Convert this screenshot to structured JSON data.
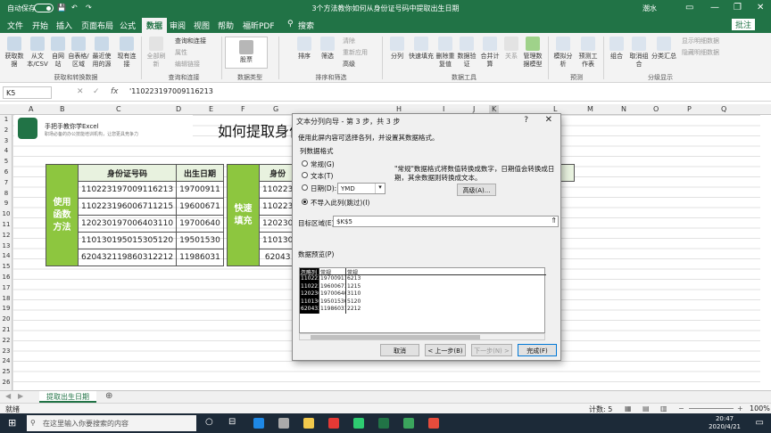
{
  "window": {
    "title": "3个方法教你如何从身份证号码中提取出生日期",
    "autosave": "自动保存",
    "toggle_state": "关",
    "user": "潮水"
  },
  "menus": [
    "文件",
    "开始",
    "插入",
    "页面布局",
    "公式",
    "数据",
    "审阅",
    "视图",
    "帮助",
    "福昕PDF",
    "搜索"
  ],
  "share_label": "批注",
  "ribbon": {
    "buttons": [
      "获取数据",
      "从文本/CSV",
      "自网站",
      "自表格/区域",
      "最近使用的源",
      "现有连接",
      "全部刷新",
      "查询和连接",
      "属性",
      "编辑链接",
      "股票",
      "排序",
      "筛选",
      "清除",
      "重新应用",
      "高级",
      "分列",
      "快速填充",
      "删除重复值",
      "数据验证",
      "合并计算",
      "关系",
      "管理数据模型",
      "模拟分析",
      "预测工作表",
      "组合",
      "取消组合",
      "分类汇总",
      "显示明细数据",
      "隐藏明细数据"
    ],
    "groups": [
      "获取和转换数据",
      "查询和连接",
      "数据类型",
      "排序和筛选",
      "数据工具",
      "预测",
      "分级显示"
    ]
  },
  "formula_bar": {
    "cell": "K5",
    "formula": "'110223197009116213"
  },
  "columns": [
    "A",
    "B",
    "C",
    "D",
    "E",
    "F",
    "G",
    "H",
    "I",
    "J",
    "K",
    "L",
    "M",
    "N",
    "O",
    "P",
    "Q"
  ],
  "rows": [
    "1",
    "2",
    "3",
    "4",
    "5",
    "6",
    "7",
    "8",
    "9",
    "10",
    "11",
    "12",
    "13",
    "14",
    "15",
    "16",
    "17",
    "18",
    "19",
    "20",
    "21",
    "22",
    "23",
    "24",
    "25",
    "26"
  ],
  "sheet": {
    "banner_title": "手把手教你学Excel",
    "banner_sub": "职场必备的办公技能培训机构，让您更具竞争力",
    "big_title": "如何提取身份",
    "left_table": {
      "label": "使用函数方法",
      "headers": [
        "身份证号码",
        "出生日期"
      ],
      "rows": [
        [
          "110223197009116213",
          "19700911"
        ],
        [
          "110223196006711215",
          "19600671"
        ],
        [
          "120230197006403110",
          "19700640"
        ],
        [
          "110130195015305120",
          "19501530"
        ],
        [
          "620432119860312212",
          "11986031"
        ]
      ]
    },
    "right_table": {
      "label": "快速填充",
      "headers": [
        "身份",
        "出生日期"
      ],
      "rows": [
        [
          "110223"
        ],
        [
          "110223"
        ],
        [
          "120230"
        ],
        [
          "110130"
        ],
        [
          "62043"
        ]
      ]
    }
  },
  "dialog": {
    "title": "文本分列向导 - 第 3 步，共 3 步",
    "help": "?",
    "close": "✕",
    "instruction": "使用此屏内容可选择各列，并设置其数据格式。",
    "col_format_label": "列数据格式",
    "radios": [
      "常规(G)",
      "文本(T)",
      "日期(D):",
      "不导入此列(跳过)(I)"
    ],
    "date_format": "YMD",
    "note": "\"常规\"数据格式将数值转换成数字，日期值会转换成日期，其余数据则转换成文本。",
    "advanced": "高级(A)...",
    "dest_label": "目标区域(E):",
    "dest_value": "$K$5",
    "preview_label": "数据预览(P)",
    "preview_headers": [
      "忽略列",
      "常规",
      "常规"
    ],
    "preview_col1": [
      "110223",
      "110223",
      "120230",
      "110130",
      "620432"
    ],
    "preview_col2": [
      "19700911",
      "19600671",
      "19700640",
      "19501530",
      "11986031"
    ],
    "preview_col3": [
      "6213",
      "1215",
      "3110",
      "5120",
      "2212"
    ],
    "buttons": {
      "cancel": "取消",
      "back": "< 上一步(B)",
      "next": "下一步(N) >",
      "finish": "完成(F)"
    }
  },
  "sheet_tab": "提取出生日期",
  "status": {
    "ready": "就绪",
    "count": "计数: 5",
    "zoom": "100%"
  },
  "taskbar": {
    "search": "在这里输入你要搜索的内容",
    "time": "20:47",
    "date": "2020/4/21"
  }
}
